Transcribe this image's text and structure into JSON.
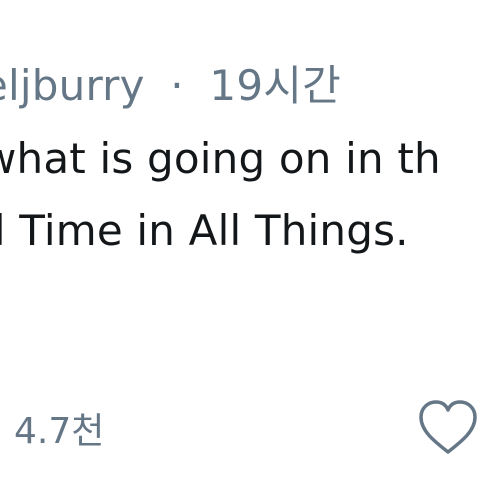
{
  "tweet": {
    "handle": "eljburry",
    "separator": "·",
    "time": "19시간",
    "text_lines": [
      "what is going on in th",
      "ll Time in All Things."
    ]
  },
  "actions": {
    "count": "4.7천",
    "like_icon": "heart-outline-icon",
    "icon_color": "#657786"
  }
}
